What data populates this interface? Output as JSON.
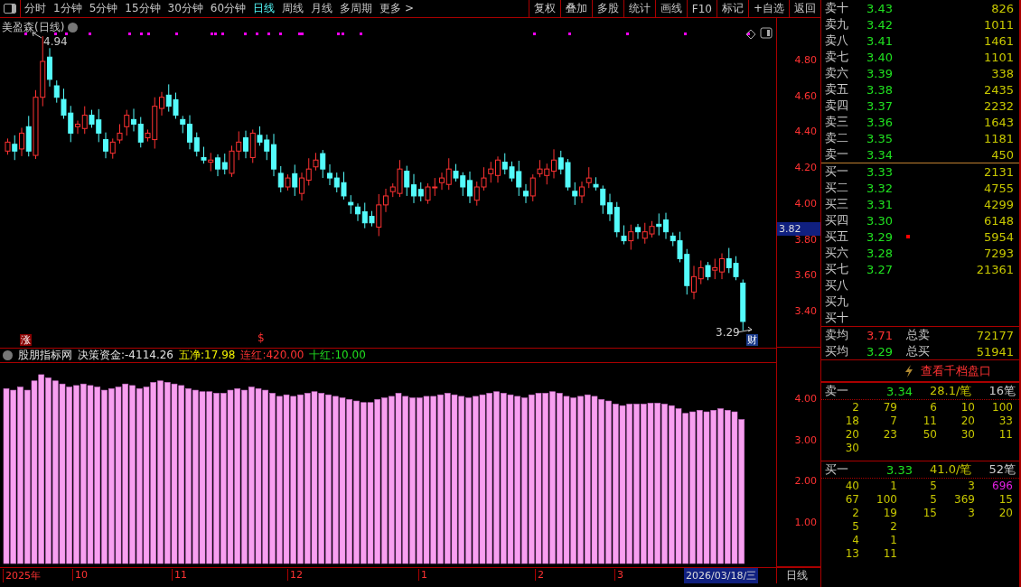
{
  "toolbar": {
    "periods": [
      {
        "label": "分时",
        "selected": false
      },
      {
        "label": "1分钟",
        "selected": false
      },
      {
        "label": "5分钟",
        "selected": false
      },
      {
        "label": "15分钟",
        "selected": false
      },
      {
        "label": "30分钟",
        "selected": false
      },
      {
        "label": "60分钟",
        "selected": false
      },
      {
        "label": "日线",
        "selected": true
      },
      {
        "label": "周线",
        "selected": false
      },
      {
        "label": "月线",
        "selected": false
      },
      {
        "label": "多周期",
        "selected": false
      },
      {
        "label": "更多 >",
        "selected": false
      }
    ],
    "buttons": [
      "复权",
      "叠加",
      "多股",
      "统计",
      "画线",
      "F10",
      "标记",
      "+自选",
      "返回"
    ]
  },
  "main_chart": {
    "title": "美盈森(日线)",
    "high_label": "4.94",
    "low_label": "3.29",
    "rise_badge": "涨",
    "dollar_mark": "$",
    "finance_badge": "财",
    "price_ticks": [
      "4.80",
      "4.60",
      "4.40",
      "4.20",
      "4.00",
      "3.80",
      "3.60",
      "3.40"
    ],
    "current_price": "3.82"
  },
  "indicator": {
    "name": "股朋指标网",
    "values": [
      {
        "text": "决策资金:-4114.26",
        "color": "#e0e0e0"
      },
      {
        "text": "五净:17.98",
        "color": "#f0f000"
      },
      {
        "text": "连红:420.00",
        "color": "#ff3232"
      },
      {
        "text": "十红:10.00",
        "color": "#20e020"
      }
    ],
    "ticks": [
      "4.00",
      "3.00",
      "2.00",
      "1.00"
    ]
  },
  "time_axis": {
    "labels": [
      "2025年",
      "10",
      "11",
      "12",
      "1",
      "2",
      "3"
    ],
    "current_date": "2026/03/18/三",
    "period": "日线"
  },
  "order_book": {
    "sell": [
      {
        "label": "卖十",
        "price": "3.43",
        "volume": "826"
      },
      {
        "label": "卖九",
        "price": "3.42",
        "volume": "1011"
      },
      {
        "label": "卖八",
        "price": "3.41",
        "volume": "1461"
      },
      {
        "label": "卖七",
        "price": "3.40",
        "volume": "1101"
      },
      {
        "label": "卖六",
        "price": "3.39",
        "volume": "338"
      },
      {
        "label": "卖五",
        "price": "3.38",
        "volume": "2435"
      },
      {
        "label": "卖四",
        "price": "3.37",
        "volume": "2232"
      },
      {
        "label": "卖三",
        "price": "3.36",
        "volume": "1643"
      },
      {
        "label": "卖二",
        "price": "3.35",
        "volume": "1181"
      },
      {
        "label": "卖一",
        "price": "3.34",
        "volume": "450"
      }
    ],
    "buy": [
      {
        "label": "买一",
        "price": "3.33",
        "volume": "2131",
        "marked": false
      },
      {
        "label": "买二",
        "price": "3.32",
        "volume": "4755",
        "marked": false
      },
      {
        "label": "买三",
        "price": "3.31",
        "volume": "4299",
        "marked": false
      },
      {
        "label": "买四",
        "price": "3.30",
        "volume": "6148",
        "marked": false
      },
      {
        "label": "买五",
        "price": "3.29",
        "volume": "5954",
        "marked": true
      },
      {
        "label": "买六",
        "price": "3.28",
        "volume": "7293",
        "marked": false
      },
      {
        "label": "买七",
        "price": "3.27",
        "volume": "21361",
        "marked": false
      },
      {
        "label": "买八",
        "marked": false
      },
      {
        "label": "买九",
        "marked": false
      },
      {
        "label": "买十",
        "marked": false
      }
    ],
    "averages": [
      {
        "label": "卖均",
        "price": "3.71",
        "color": "#ff3232",
        "total_label": "总卖",
        "total": "72177"
      },
      {
        "label": "买均",
        "price": "3.29",
        "color": "#20e020",
        "total_label": "总买",
        "total": "51941"
      }
    ],
    "depth_link": "查看千档盘口"
  },
  "queues": [
    {
      "label": "卖一",
      "price": "3.34",
      "avg": "28.1/笔",
      "count": "16笔",
      "rows": [
        [
          "2",
          "79",
          "6",
          "10",
          "100"
        ],
        [
          "18",
          "7",
          "11",
          "20",
          "33"
        ],
        [
          "20",
          "23",
          "50",
          "30",
          "11"
        ],
        [
          "30"
        ]
      ]
    },
    {
      "label": "买一",
      "price": "3.33",
      "avg": "41.0/笔",
      "count": "52笔",
      "rows": [
        [
          {
            "text": "40",
            "color": "#c8c800"
          },
          {
            "text": "1",
            "color": "#c8c800"
          },
          {
            "text": "5",
            "color": "#c8c800"
          },
          {
            "text": "3",
            "color": "#c8c800"
          },
          {
            "text": "696",
            "color": "#e020e0"
          }
        ],
        [
          {
            "text": "67",
            "color": "#c8c800"
          },
          {
            "text": "100",
            "color": "#c8c800"
          },
          {
            "text": "5",
            "color": "#c8c800"
          },
          {
            "text": "369",
            "color": "#c8c800"
          },
          {
            "text": "15",
            "color": "#c8c800"
          }
        ],
        [
          {
            "text": "2",
            "color": "#c8c800"
          },
          {
            "text": "19",
            "color": "#c8c800"
          },
          {
            "text": "15",
            "color": "#c8c800"
          },
          {
            "text": "3",
            "color": "#c8c800"
          },
          {
            "text": "20",
            "color": "#c8c800"
          }
        ],
        [
          {
            "text": "5",
            "color": "#c8c800"
          },
          {
            "text": "2",
            "color": "#c8c800"
          }
        ],
        [
          {
            "text": "4",
            "color": "#c8c800"
          },
          {
            "text": "1",
            "color": "#c8c800"
          }
        ],
        [
          {
            "text": "13",
            "color": "#c8c800"
          },
          {
            "text": "11",
            "color": "#c8c800"
          }
        ]
      ]
    }
  ]
}
